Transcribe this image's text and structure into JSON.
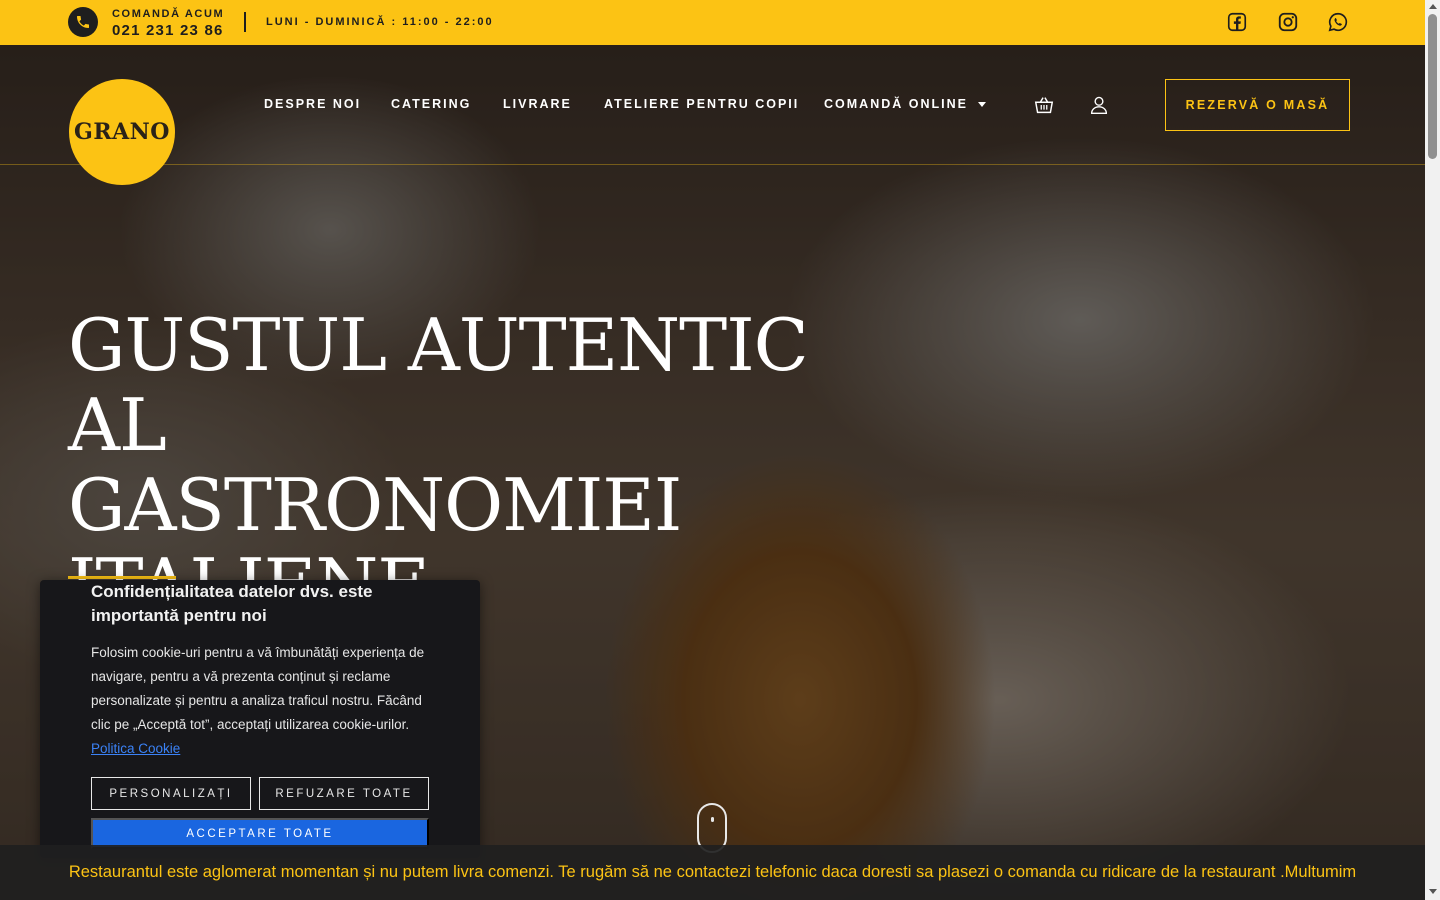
{
  "topbar": {
    "order_label": "COMANDĂ ACUM",
    "phone": "021 231 23 86",
    "hours": "LUNI - DUMINICĂ  :  11:00 - 22:00",
    "social": [
      "facebook-icon",
      "instagram-icon",
      "whatsapp-icon"
    ],
    "background": "#fcc314"
  },
  "header": {
    "logo_text": "GRANO",
    "nav": {
      "about": "DESPRE NOI",
      "catering": "CATERING",
      "delivery": "LIVRARE",
      "kids": "ATELIERE PENTRU COPII",
      "online": "COMANDĂ ONLINE"
    },
    "icons": [
      "cart-icon",
      "user-icon"
    ],
    "reserve": "REZERVĂ O MASĂ"
  },
  "hero": {
    "title_lines": [
      "GUSTUL AUTENTIC AL",
      "GASTRONOMIEI",
      "ITALIENE"
    ]
  },
  "cookie": {
    "title": "Confidențialitatea datelor dvs. este importantă pentru noi",
    "text": "Folosim cookie-uri pentru a vă îmbunătăți experiența de navigare, pentru a vă prezenta conținut și reclame personalizate și pentru a analiza traficul nostru. Făcând clic pe „Acceptă tot”, acceptați utilizarea cookie-urilor.",
    "link": "Politica Cookie",
    "customize": "PERSONALIZAȚI",
    "reject": "REFUZARE TOATE",
    "accept": "ACCEPTARE TOATE",
    "accent": "#1a66e0"
  },
  "notice": {
    "text": "Restaurantul este aglomerat momentan și nu putem livra comenzi. Te rugăm să ne contactezi telefonic daca doresti sa plasezi o comanda cu ridicare de la restaurant .Multumim"
  }
}
